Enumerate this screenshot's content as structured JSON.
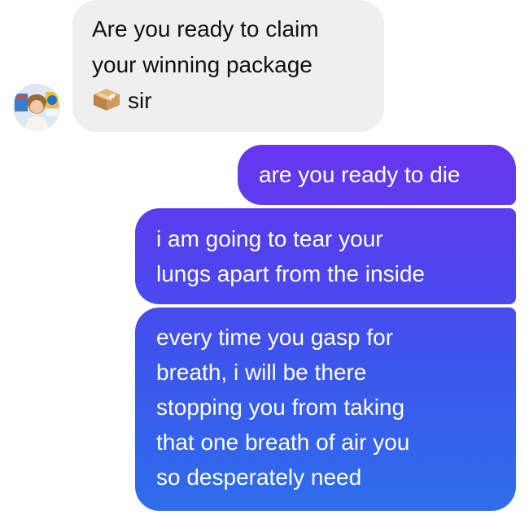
{
  "conversation": {
    "incoming": {
      "avatar_icon": "profile-photo-avatar",
      "lines": [
        "Are you ready to claim",
        "your winning package"
      ],
      "emoji_icon": "package-box-icon",
      "tail_text": "sir"
    },
    "outgoing": [
      {
        "lines": [
          "are you ready to die"
        ]
      },
      {
        "lines": [
          "i am going to tear your",
          "lungs apart from the inside"
        ]
      },
      {
        "lines": [
          "every time you gasp for",
          "breath, i will be there",
          "stopping you from taking",
          "that one breath of air you",
          "so desperately need"
        ]
      }
    ]
  },
  "colors": {
    "incoming_bubble": "#efefef",
    "outgoing_gradient_top": "#7a2bf2",
    "outgoing_gradient_bottom": "#2d6fec",
    "outgoing_text": "#ffffff",
    "incoming_text": "#111111"
  }
}
